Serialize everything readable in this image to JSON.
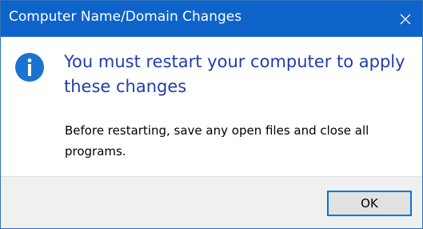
{
  "window": {
    "title": "Computer Name/Domain Changes",
    "close_icon": "close-icon"
  },
  "message": {
    "icon": "info-icon",
    "main_instruction": "You must restart your computer to apply these changes",
    "body": "Before restarting, save any open files and close all programs."
  },
  "footer": {
    "ok_label": "OK"
  },
  "colors": {
    "titlebar": "#0d63c9",
    "main_instruction": "#1f3ea8",
    "info_icon": "#1a73cf",
    "button_focus_border": "#0078d7"
  }
}
